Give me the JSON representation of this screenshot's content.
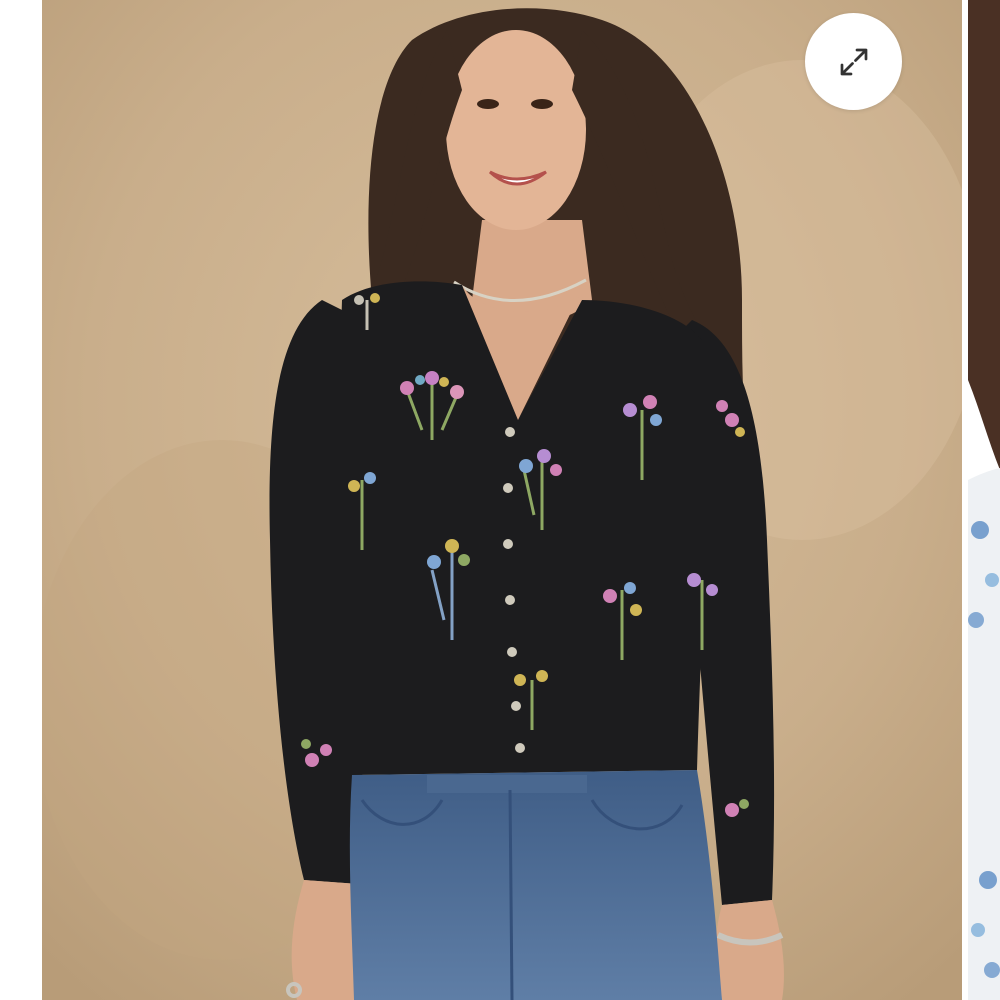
{
  "gallery": {
    "main_image": {
      "icon": "product-photo",
      "background_color": "#c9ae8b",
      "cardigan_color": "#1c1c1e",
      "jeans_color": "#4d6b91",
      "hair_color": "#3b2a20"
    },
    "next_image": {
      "icon": "product-photo-next",
      "accent_color": "#5a8cc4"
    },
    "expand_button": {
      "icon": "expand-icon"
    }
  }
}
